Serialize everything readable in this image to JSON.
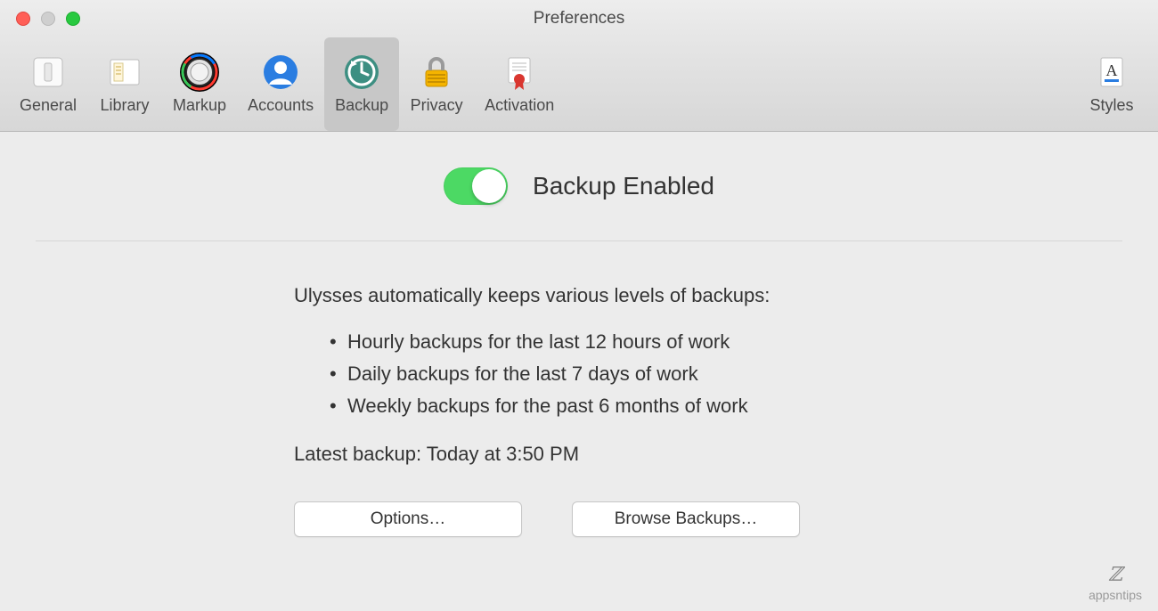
{
  "window": {
    "title": "Preferences"
  },
  "toolbar": {
    "items": [
      {
        "label": "General",
        "name": "tab-general"
      },
      {
        "label": "Library",
        "name": "tab-library"
      },
      {
        "label": "Markup",
        "name": "tab-markup"
      },
      {
        "label": "Accounts",
        "name": "tab-accounts"
      },
      {
        "label": "Backup",
        "name": "tab-backup",
        "selected": true
      },
      {
        "label": "Privacy",
        "name": "tab-privacy"
      },
      {
        "label": "Activation",
        "name": "tab-activation"
      }
    ],
    "right": {
      "label": "Styles",
      "name": "tab-styles"
    }
  },
  "backup": {
    "toggle_label": "Backup Enabled",
    "toggle_on": true,
    "description": "Ulysses automatically keeps various levels of backups:",
    "points": [
      "Hourly backups for the last 12 hours of work",
      "Daily backups for the last 7 days of work",
      "Weekly backups for the past 6 months of work"
    ],
    "latest_backup": "Latest backup: Today at 3:50 PM",
    "options_button": "Options…",
    "browse_button": "Browse Backups…"
  },
  "watermark": "appsntips"
}
